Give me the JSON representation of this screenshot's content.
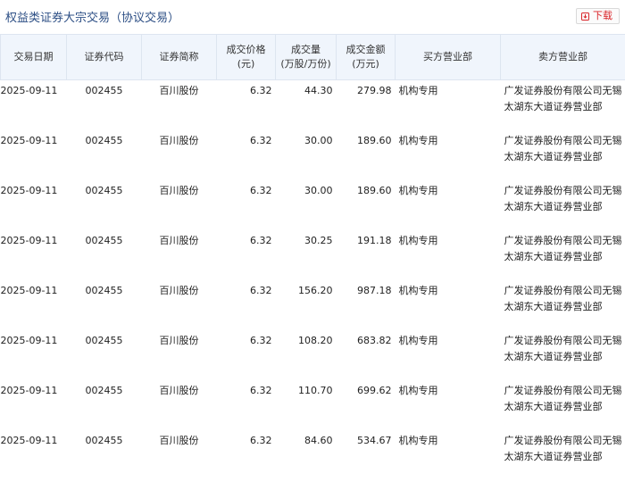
{
  "header": {
    "title": "权益类证券大宗交易（协议交易）",
    "download_label": "下载",
    "accent_color": "#d9252a",
    "title_color": "#2d4f85"
  },
  "table": {
    "columns": {
      "date": "交易日期",
      "code": "证券代码",
      "name": "证券简称",
      "price": [
        "成交价格",
        "(元)"
      ],
      "volume": [
        "成交量",
        "(万股/万份)"
      ],
      "amount": [
        "成交金额",
        "(万元)"
      ],
      "buyer": "买方营业部",
      "seller": "卖方营业部"
    },
    "rows": [
      {
        "date": "2025-09-11",
        "code": "002455",
        "name": "百川股份",
        "price": "6.32",
        "volume": "44.30",
        "amount": "279.98",
        "buyer": "机构专用",
        "seller": "广发证券股份有限公司无锡太湖东大道证券营业部"
      },
      {
        "date": "2025-09-11",
        "code": "002455",
        "name": "百川股份",
        "price": "6.32",
        "volume": "30.00",
        "amount": "189.60",
        "buyer": "机构专用",
        "seller": "广发证券股份有限公司无锡太湖东大道证券营业部"
      },
      {
        "date": "2025-09-11",
        "code": "002455",
        "name": "百川股份",
        "price": "6.32",
        "volume": "30.00",
        "amount": "189.60",
        "buyer": "机构专用",
        "seller": "广发证券股份有限公司无锡太湖东大道证券营业部"
      },
      {
        "date": "2025-09-11",
        "code": "002455",
        "name": "百川股份",
        "price": "6.32",
        "volume": "30.25",
        "amount": "191.18",
        "buyer": "机构专用",
        "seller": "广发证券股份有限公司无锡太湖东大道证券营业部"
      },
      {
        "date": "2025-09-11",
        "code": "002455",
        "name": "百川股份",
        "price": "6.32",
        "volume": "156.20",
        "amount": "987.18",
        "buyer": "机构专用",
        "seller": "广发证券股份有限公司无锡太湖东大道证券营业部"
      },
      {
        "date": "2025-09-11",
        "code": "002455",
        "name": "百川股份",
        "price": "6.32",
        "volume": "108.20",
        "amount": "683.82",
        "buyer": "机构专用",
        "seller": "广发证券股份有限公司无锡太湖东大道证券营业部"
      },
      {
        "date": "2025-09-11",
        "code": "002455",
        "name": "百川股份",
        "price": "6.32",
        "volume": "110.70",
        "amount": "699.62",
        "buyer": "机构专用",
        "seller": "广发证券股份有限公司无锡太湖东大道证券营业部"
      },
      {
        "date": "2025-09-11",
        "code": "002455",
        "name": "百川股份",
        "price": "6.32",
        "volume": "84.60",
        "amount": "534.67",
        "buyer": "机构专用",
        "seller": "广发证券股份有限公司无锡太湖东大道证券营业部"
      }
    ]
  }
}
